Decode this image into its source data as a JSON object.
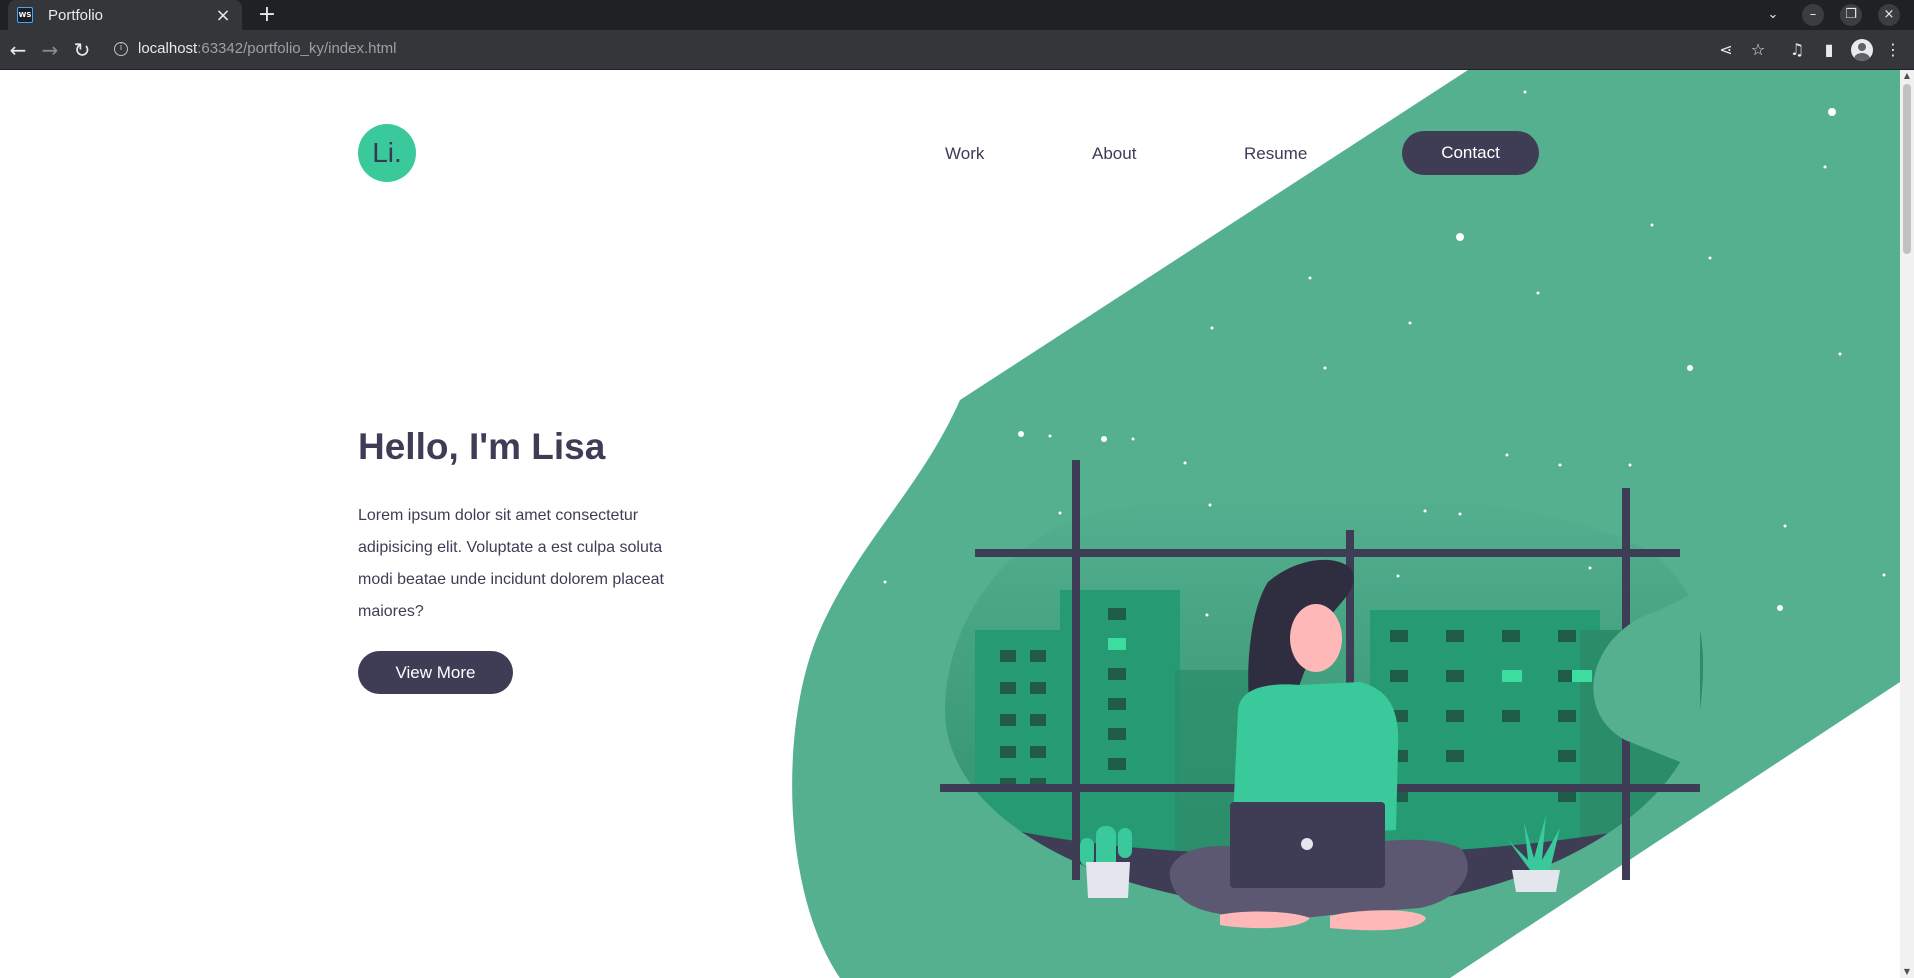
{
  "browser": {
    "tab_title": "Portfolio",
    "favicon_text": "WS",
    "url_host": "localhost",
    "url_rest": ":63342/portfolio_ky/index.html"
  },
  "page": {
    "logo_text": "Li.",
    "nav": {
      "work": "Work",
      "about": "About",
      "resume": "Resume",
      "contact": "Contact"
    },
    "hero": {
      "title": "Hello, I'm Lisa",
      "text": "Lorem ipsum dolor sit amet consectetur adipisicing elit. Voluptate a est culpa soluta modi beatae unde incidunt dolorem placeat maiores?",
      "button": "View More"
    }
  },
  "colors": {
    "primary_dark": "#3f3d56",
    "accent_green": "#3ac99a",
    "blob_green": "#55b090",
    "building_green": "#269a72"
  },
  "icons": [
    "favicon-icon",
    "close-tab-icon",
    "new-tab-icon",
    "back-icon",
    "forward-icon",
    "reload-icon",
    "info-icon",
    "share-icon",
    "bookmark-star-icon",
    "media-icon",
    "side-panel-icon",
    "profile-icon",
    "menu-icon"
  ]
}
